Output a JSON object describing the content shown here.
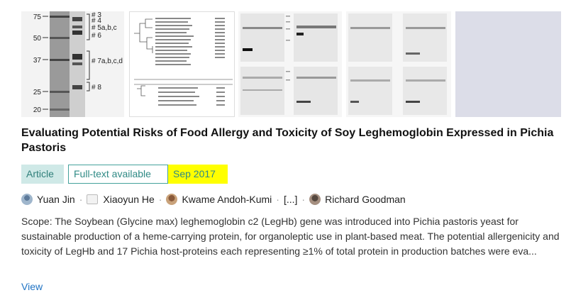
{
  "figures": {
    "gel_markers": [
      "75",
      "50",
      "37",
      "25",
      "20"
    ],
    "gel_labels": [
      "# 3",
      "# 4",
      "# 5a,b,c",
      "# 6",
      "# 7a,b,c,d",
      "# 8"
    ]
  },
  "paper": {
    "title": "Evaluating Potential Risks of Food Allergy and Toxicity of Soy Leghemoglobin Expressed in Pichia Pastoris",
    "type_badge": "Article",
    "fulltext_badge": "Full-text available",
    "date": "Sep 2017",
    "authors": [
      "Yuan Jin",
      "Xiaoyun He",
      "Kwame Andoh-Kumi",
      "[...]",
      "Richard Goodman"
    ],
    "abstract": "Scope: The Soybean (Glycine max) leghemoglobin c2 (LegHb) gene was introduced into Pichia pastoris yeast for sustainable production of a heme-carrying protein, for organoleptic use in plant-based meat. The potential allergenicity and toxicity of LegHb and 17 Pichia host-proteins each representing ≥1% of total protein in production batches were eva...",
    "view_label": "View"
  },
  "colors": {
    "badge_fill": "#cfe9e7",
    "teal": "#2f8a85",
    "highlight": "#ffff00",
    "link": "#1f73c4"
  }
}
